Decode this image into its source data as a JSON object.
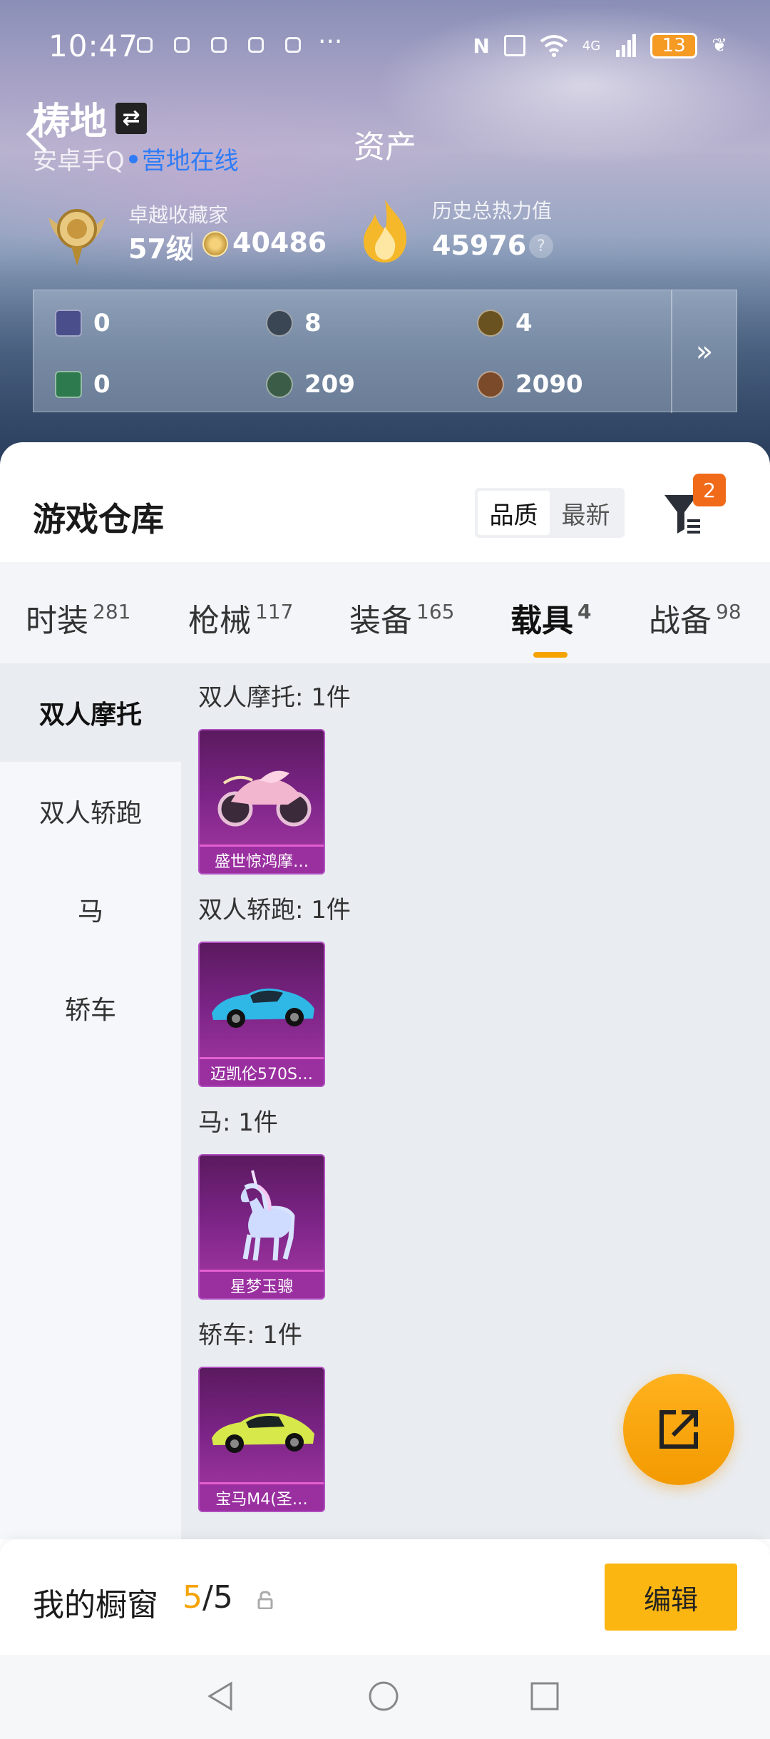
{
  "status_bar": {
    "time": "10:47",
    "more": "···",
    "network": "4G",
    "battery": "13"
  },
  "header": {
    "title": "资产",
    "user_name": "梼地",
    "platform": "安卓手Q",
    "status": "营地在线"
  },
  "profile": {
    "collector_label": "卓越收藏家",
    "collector_level": "57级",
    "coins": "40486",
    "heat_label": "历史总热力值",
    "heat_value": "45976",
    "help": "?"
  },
  "stats": {
    "row1": [
      "0",
      "8",
      "4"
    ],
    "row2": [
      "0",
      "209",
      "2090"
    ],
    "more": "»"
  },
  "warehouse": {
    "title": "游戏仓库",
    "sort_options": [
      "品质",
      "最新"
    ],
    "sort_selected": "品质",
    "filter_badge": "2"
  },
  "tabs": [
    {
      "label": "时装",
      "count": "281"
    },
    {
      "label": "枪械",
      "count": "117"
    },
    {
      "label": "装备",
      "count": "165"
    },
    {
      "label": "载具",
      "count": "4",
      "active": true
    },
    {
      "label": "战备",
      "count": "98"
    }
  ],
  "side_nav": [
    "双人摩托",
    "双人轿跑",
    "马",
    "轿车"
  ],
  "groups": [
    {
      "label": "双人摩托: 1件",
      "item": "盛世惊鸿摩…"
    },
    {
      "label": "双人轿跑: 1件",
      "item": "迈凯伦570S…"
    },
    {
      "label": "马: 1件",
      "item": "星梦玉骢"
    },
    {
      "label": "轿车: 1件",
      "item": "宝马M4(圣…"
    }
  ],
  "showcase": {
    "label": "我的橱窗",
    "current": "5",
    "total": "/5",
    "edit": "编辑"
  },
  "colors": {
    "accent": "#f5a300",
    "online": "#2f7cf6",
    "badge": "#f06a1a",
    "item_rarity": "#9a2fa0"
  }
}
